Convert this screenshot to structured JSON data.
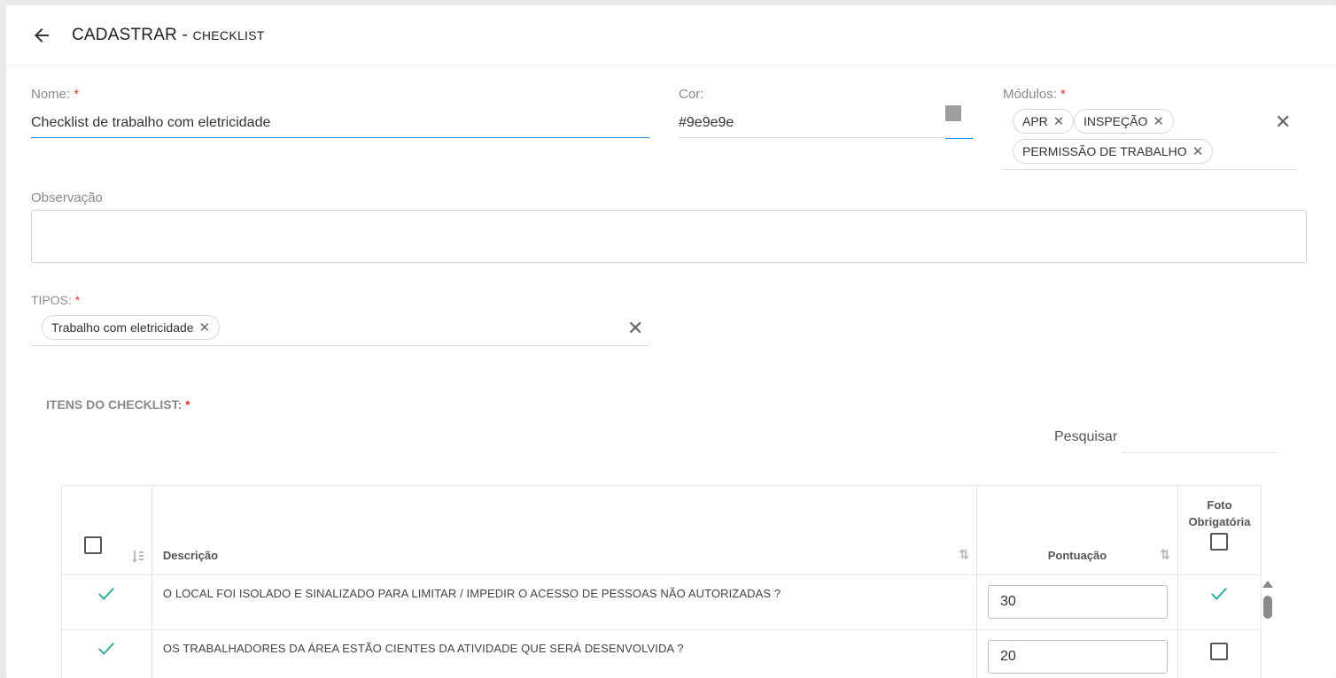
{
  "header": {
    "title": "CADASTRAR - ",
    "subtitle": "CHECKLIST"
  },
  "nome": {
    "label": "Nome:",
    "required": "*",
    "value": "Checklist de trabalho com eletricidade"
  },
  "cor": {
    "label": "Cor:",
    "value": "#9e9e9e",
    "swatch_color": "#9e9e9e"
  },
  "modulos": {
    "label": "Módulos:",
    "required": "*",
    "chips": [
      "APR",
      "INSPEÇÃO",
      "PERMISSÃO DE TRABALHO"
    ]
  },
  "observacao": {
    "label": "Observação",
    "value": ""
  },
  "tipos": {
    "label": "TIPOS:",
    "required": "*",
    "chips": [
      "Trabalho com eletricidade"
    ]
  },
  "itens": {
    "title": "ITENS DO CHECKLIST:",
    "required": "*",
    "search_label": "Pesquisar",
    "columns": {
      "descricao": "Descrição",
      "pontuacao": "Pontuação",
      "foto": "Foto Obrigatória"
    },
    "rows": [
      {
        "selected": true,
        "descricao": "O LOCAL FOI ISOLADO E SINALIZADO PARA LIMITAR / IMPEDIR O ACESSO DE PESSOAS NÃO AUTORIZADAS ?",
        "pontuacao": "30",
        "foto": true
      },
      {
        "selected": true,
        "descricao": "OS TRABALHADORES DA ÁREA ESTÃO CIENTES DA ATIVIDADE QUE SERÁ DESENVOLVIDA ?",
        "pontuacao": "20",
        "foto": false
      }
    ]
  },
  "colors": {
    "accent": "#1e88e5",
    "check": "#26a69a",
    "required": "#e53935"
  }
}
